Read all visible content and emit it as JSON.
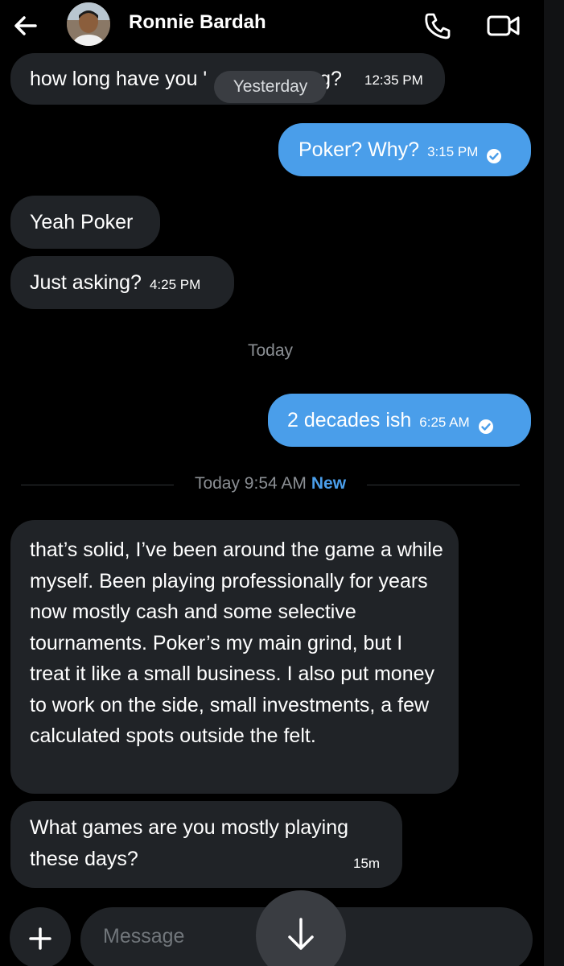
{
  "header": {
    "contact_name": "Ronnie Bardah",
    "icons": {
      "back": "arrow-left-icon",
      "call": "phone-icon",
      "video": "video-call-icon"
    }
  },
  "messages": [
    {
      "direction": "incoming",
      "text": "how long have you been playing?",
      "visible_text_left": "how long have you '",
      "visible_text_right": "ng?",
      "time": "12:35 PM"
    },
    {
      "direction": "outgoing",
      "text": "Poker? Why?",
      "time": "3:15 PM",
      "status": "read"
    },
    {
      "direction": "incoming",
      "text": "Yeah Poker"
    },
    {
      "direction": "incoming",
      "text": "Just asking?",
      "time": "4:25 PM"
    },
    {
      "direction": "outgoing",
      "text": "2 decades ish",
      "time": "6:25 AM",
      "status": "read"
    },
    {
      "direction": "incoming",
      "text": "that’s solid, I’ve been around the game a while myself. Been playing professionally for years now mostly cash and some selective tournaments. Poker’s my main grind, but I treat it like a small business. I also put money to work on the side, small investments, a few calculated spots outside the felt."
    },
    {
      "direction": "incoming",
      "text": "What games are you mostly playing these days?",
      "time": "15m"
    }
  ],
  "date_pill": "Yesterday",
  "date_separator": "Today",
  "new_divider": {
    "label": "Today 9:54 AM",
    "badge": "New"
  },
  "composer": {
    "placeholder": "Message",
    "icons": {
      "add": "plus-icon",
      "scroll": "arrow-down-icon"
    }
  },
  "colors": {
    "background": "#000000",
    "incoming_bubble": "#202327",
    "outgoing_bubble": "#4a9eea",
    "accent": "#4a9eea"
  }
}
